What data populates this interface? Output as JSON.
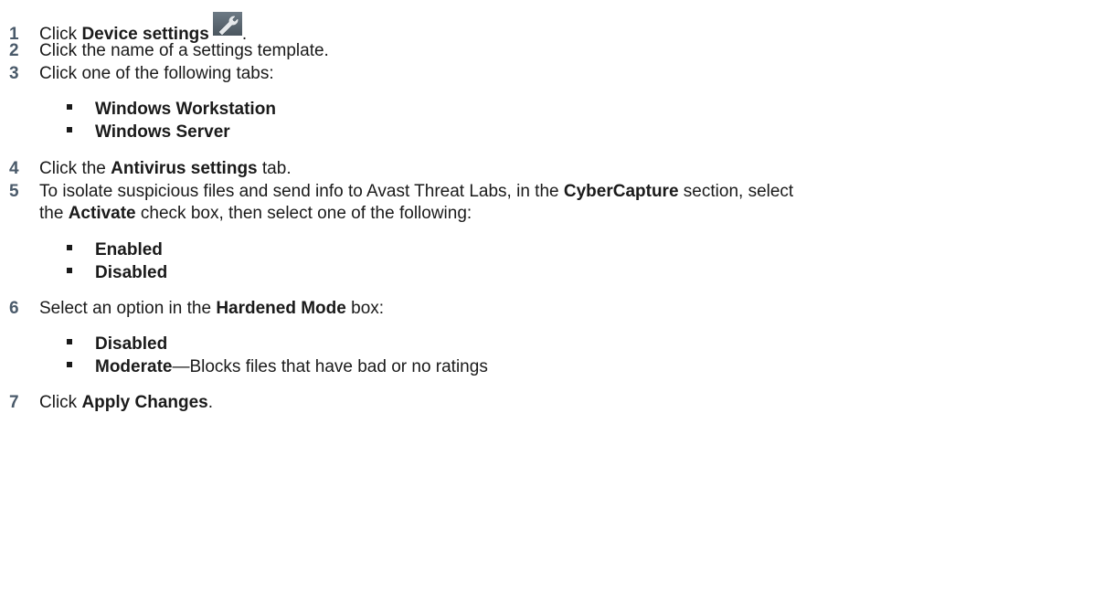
{
  "steps": [
    {
      "num": "1",
      "pre": "Click ",
      "bold": "Device settings",
      "icon": "wrench-icon",
      "post": "."
    },
    {
      "num": "2",
      "text": "Click the name of a settings template."
    },
    {
      "num": "3",
      "text": "Click one of the following tabs:"
    },
    {
      "num": "4",
      "pre": "Click the ",
      "bold": "Antivirus settings",
      "post": " tab."
    },
    {
      "num": "5",
      "line1_pre": "To isolate suspicious files and send info to Avast Threat Labs, in the ",
      "line1_bold": "CyberCapture",
      "line1_post": " section, select",
      "line2_pre": "the ",
      "line2_bold": "Activate",
      "line2_post": " check box, then select one of the following:"
    },
    {
      "num": "6",
      "pre": "Select an option in the ",
      "bold": "Hardened Mode",
      "post": " box:"
    },
    {
      "num": "7",
      "pre": "Click ",
      "bold": "Apply Changes",
      "post": "."
    }
  ],
  "bullets_step3": [
    "Windows Workstation",
    "Windows Server"
  ],
  "bullets_step5": [
    "Enabled",
    "Disabled"
  ],
  "bullets_step6": [
    {
      "bold": "Disabled",
      "rest": ""
    },
    {
      "bold": "Moderate",
      "rest": "—Blocks files that have bad or no ratings"
    }
  ]
}
